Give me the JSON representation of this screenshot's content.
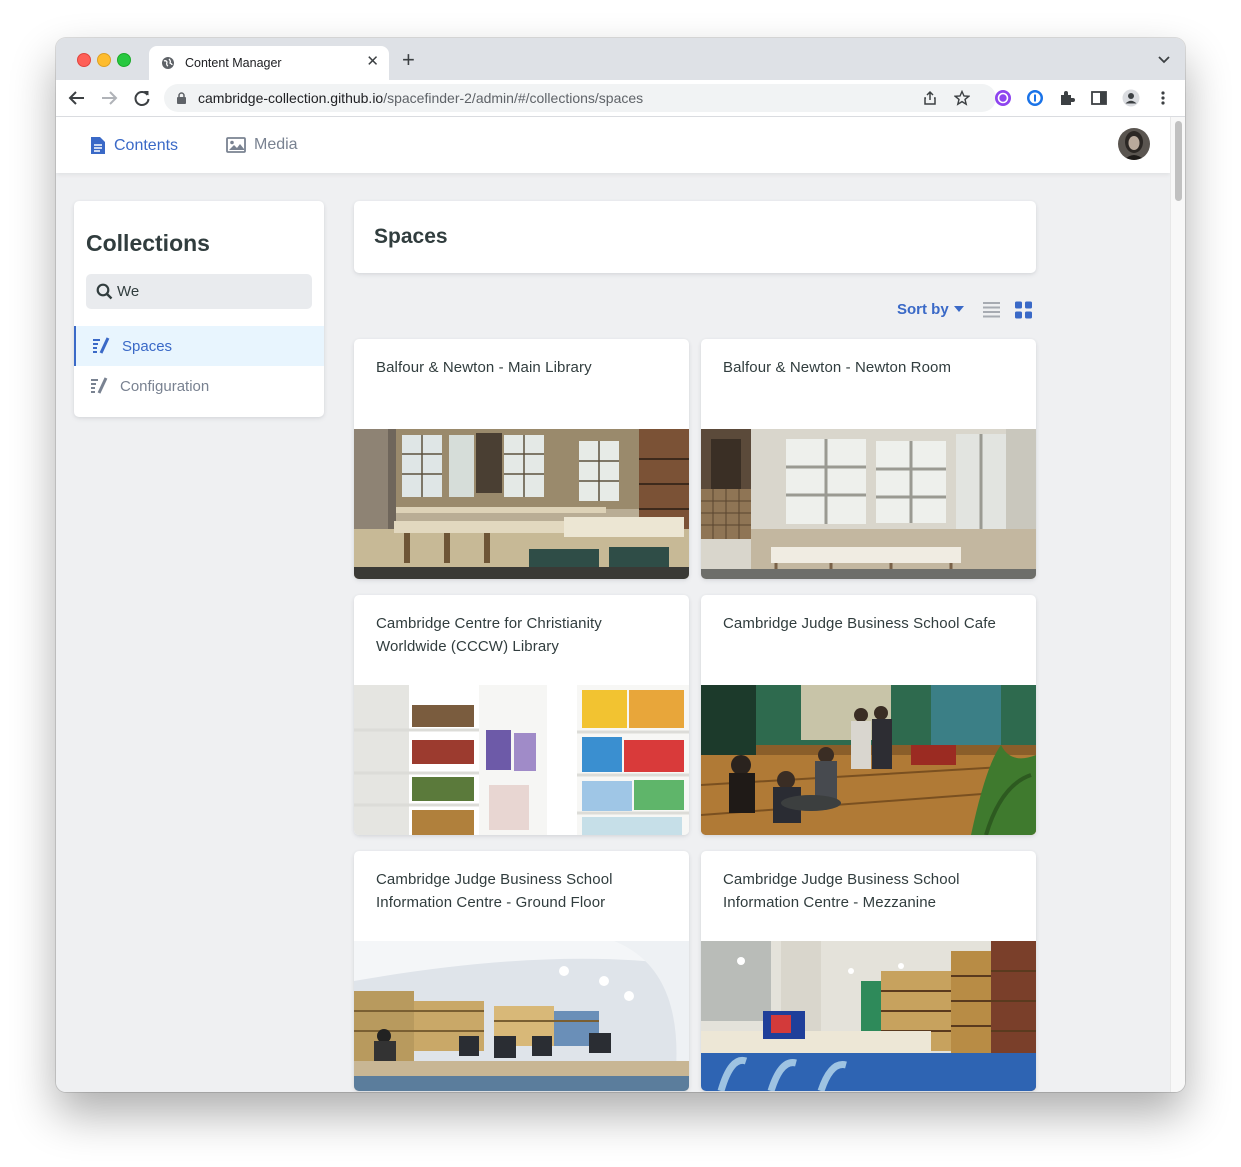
{
  "browser": {
    "tab_title": "Content Manager",
    "new_tab": "+",
    "close": "✕",
    "url_host": "cambridge-collection.github.io",
    "url_path": "/spacefinder-2/admin/#/collections/spaces"
  },
  "app": {
    "nav_contents": "Contents",
    "nav_media": "Media"
  },
  "sidebar": {
    "title": "Collections",
    "search_value": "We",
    "items": [
      {
        "label": "Spaces",
        "active": true
      },
      {
        "label": "Configuration",
        "active": false
      }
    ]
  },
  "main": {
    "title": "Spaces",
    "sort_label": "Sort by"
  },
  "cards": [
    {
      "title": "Balfour & Newton - Main Library"
    },
    {
      "title": "Balfour & Newton - Newton Room"
    },
    {
      "title": "Cambridge Centre for Christianity Worldwide (CCCW) Library"
    },
    {
      "title": "Cambridge Judge Business School Cafe"
    },
    {
      "title": "Cambridge Judge Business School Information Centre - Ground Floor"
    },
    {
      "title": "Cambridge Judge Business School Information Centre - Mezzanine"
    }
  ],
  "colors": {
    "accent": "#3a69c7",
    "muted": "#798291",
    "text": "#313d3e",
    "page_bg": "#eff0f2",
    "active_bg": "#e8f5fe"
  }
}
